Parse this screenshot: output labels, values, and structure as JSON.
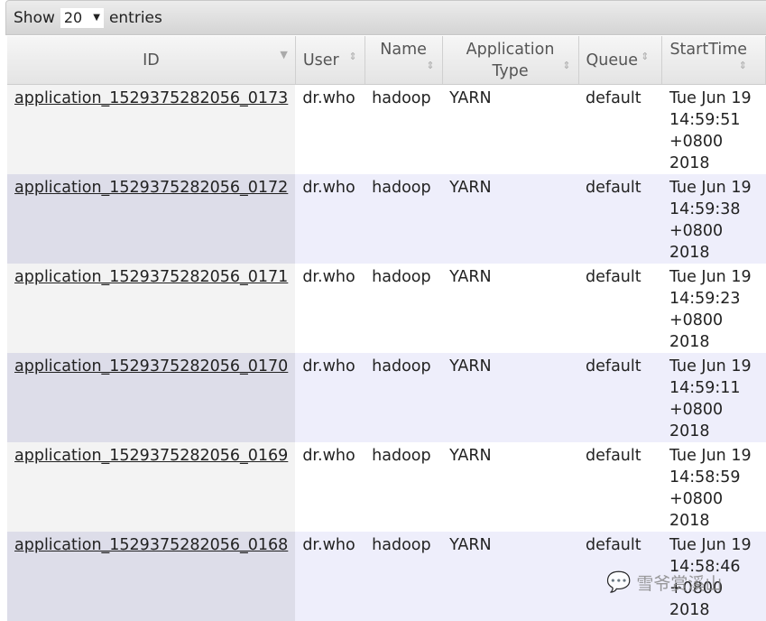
{
  "toolbar": {
    "show": "Show",
    "value": "20",
    "entries": "entries"
  },
  "columns": [
    "ID",
    "User",
    "Name",
    "Application Type",
    "Queue",
    "StartTime"
  ],
  "rows": [
    {
      "id": "application_1529375282056_0173",
      "user": "dr.who",
      "name": "hadoop",
      "type": "YARN",
      "queue": "default",
      "start": [
        "Tue Jun 19",
        "14:59:51",
        "+0800",
        "2018"
      ]
    },
    {
      "id": "application_1529375282056_0172",
      "user": "dr.who",
      "name": "hadoop",
      "type": "YARN",
      "queue": "default",
      "start": [
        "Tue Jun 19",
        "14:59:38",
        "+0800",
        "2018"
      ]
    },
    {
      "id": "application_1529375282056_0171",
      "user": "dr.who",
      "name": "hadoop",
      "type": "YARN",
      "queue": "default",
      "start": [
        "Tue Jun 19",
        "14:59:23",
        "+0800",
        "2018"
      ]
    },
    {
      "id": "application_1529375282056_0170",
      "user": "dr.who",
      "name": "hadoop",
      "type": "YARN",
      "queue": "default",
      "start": [
        "Tue Jun 19",
        "14:59:11",
        "+0800",
        "2018"
      ]
    },
    {
      "id": "application_1529375282056_0169",
      "user": "dr.who",
      "name": "hadoop",
      "type": "YARN",
      "queue": "default",
      "start": [
        "Tue Jun 19",
        "14:58:59",
        "+0800",
        "2018"
      ]
    },
    {
      "id": "application_1529375282056_0168",
      "user": "dr.who",
      "name": "hadoop",
      "type": "YARN",
      "queue": "default",
      "start": [
        "Tue Jun 19",
        "14:58:46",
        "+0800",
        "2018"
      ]
    }
  ],
  "watermark": "雪爷赏溪山"
}
